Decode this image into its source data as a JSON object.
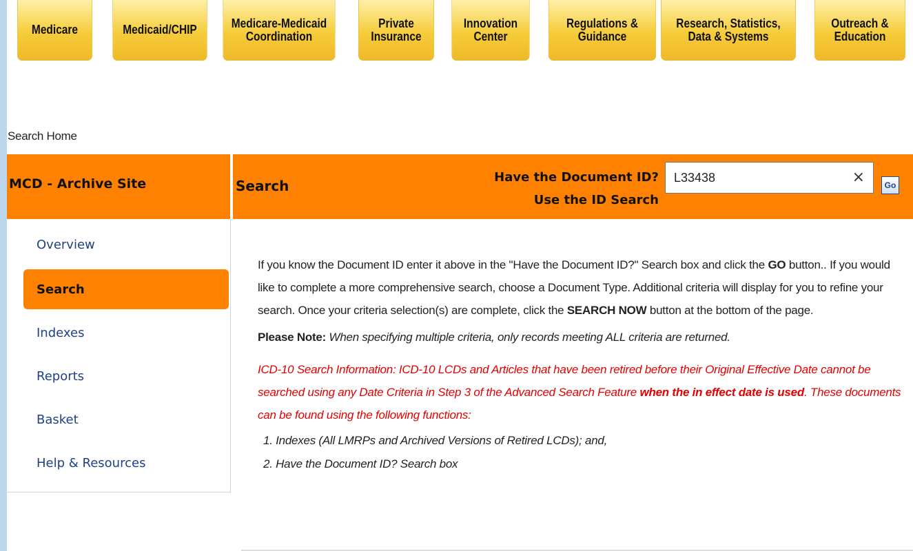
{
  "nav": {
    "tabs": [
      {
        "label": "Medicare"
      },
      {
        "label": "Medicaid/CHIP"
      },
      {
        "label": "Medicare-Medicaid\nCoordination"
      },
      {
        "label": "Private\nInsurance"
      },
      {
        "label": "Innovation\nCenter"
      },
      {
        "label": "Regulations &\nGuidance"
      },
      {
        "label": "Research, Statistics,\nData & Systems"
      },
      {
        "label": "Outreach &\nEducation"
      }
    ]
  },
  "breadcrumb": "Search Home",
  "header": {
    "site_title": "MCD - Archive Site",
    "section_title": "Search",
    "docid_prompt_line1": "Have the Document ID?",
    "docid_prompt_line2": "Use the ID Search",
    "docid_value": "L33438",
    "clear_symbol": "×",
    "go_label": "Go"
  },
  "sidebar": {
    "items": [
      {
        "label": "Overview",
        "active": false
      },
      {
        "label": "Search",
        "active": true
      },
      {
        "label": "Indexes",
        "active": false
      },
      {
        "label": "Reports",
        "active": false
      },
      {
        "label": "Basket",
        "active": false
      },
      {
        "label": "Help & Resources",
        "active": false
      }
    ]
  },
  "main": {
    "intro_part1": "If you know the Document ID enter it above in the \"Have the Document ID?\" Search box and click the ",
    "intro_go": "GO",
    "intro_part2": " button.. If you would like to complete a more comprehensive search, choose a Document Type. Additional criteria will display for you to refine your search. Once your criteria selection(s) are complete, click the ",
    "intro_search_now": "SEARCH NOW",
    "intro_part3": " button at the bottom of the page.",
    "note_label": "Please Note:",
    "note_text": " When specifying multiple criteria, only records meeting ALL criteria are returned.",
    "icd_part1": "ICD-10 Search Information: ICD-10 LCDs and Articles that have been retired before their Original Effective Date cannot be searched using any Date Criteria in Step 3 of the Advanced Search Feature ",
    "icd_bold": "when the in effect date is used",
    "icd_part2": ". These documents can be found using the following functions:",
    "steps": [
      "1.  Indexes (All LMRPs and Archived Versions of Retired LCDs); and,",
      "2.  Have the Document ID? Search box"
    ]
  },
  "colors": {
    "orange": "#ff8100",
    "nav_yellow": "#f5cc3a",
    "link_blue": "#1f3f86",
    "alert_red": "#e30000"
  }
}
